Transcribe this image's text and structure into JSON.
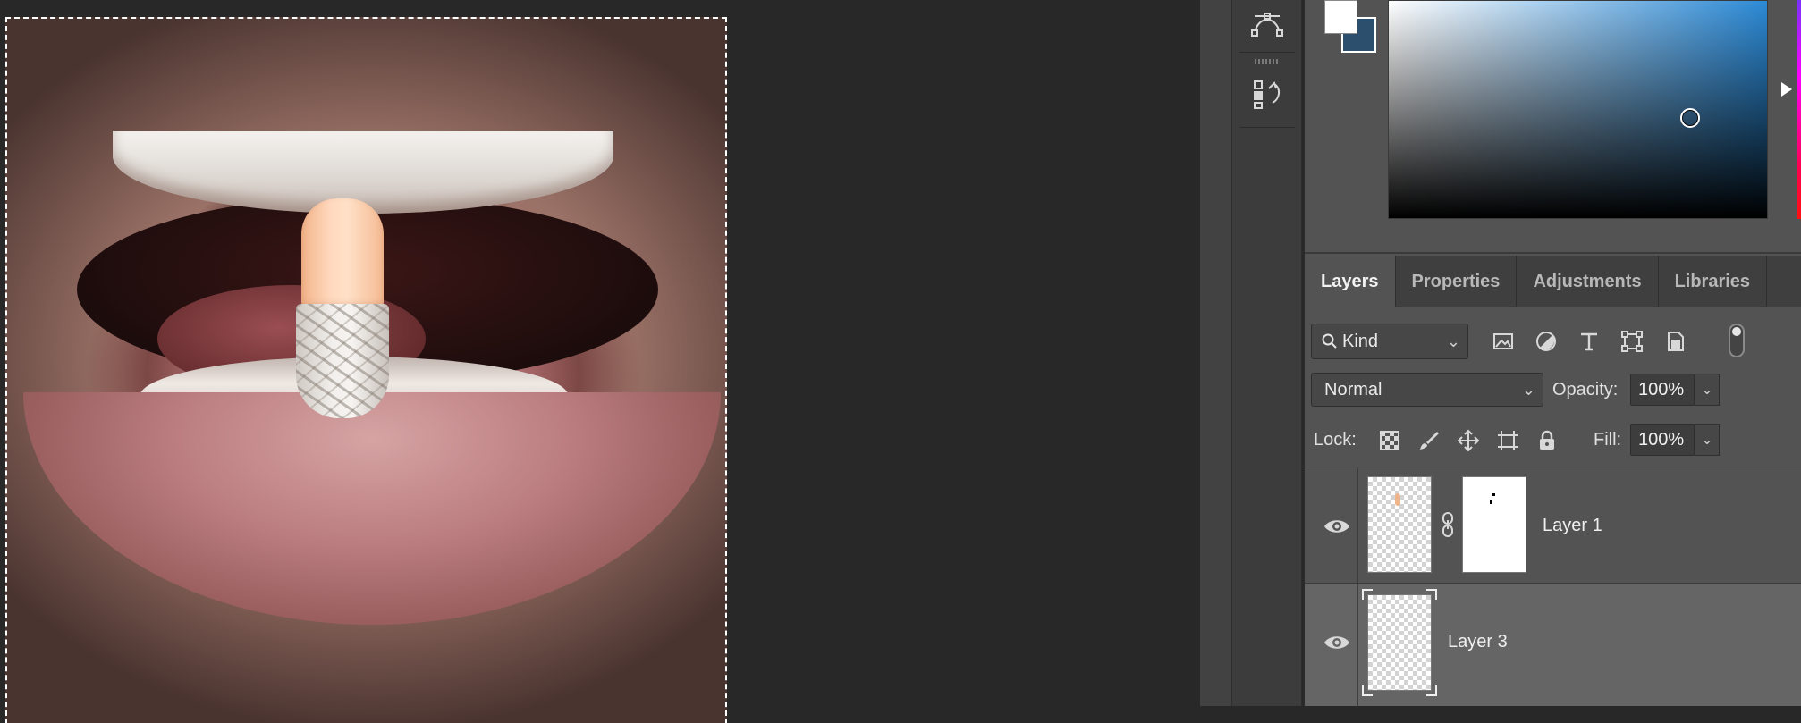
{
  "panels": {
    "tabs": [
      {
        "label": "Layers",
        "active": true
      },
      {
        "label": "Properties",
        "active": false
      },
      {
        "label": "Adjustments",
        "active": false
      },
      {
        "label": "Libraries",
        "active": false
      }
    ],
    "filter": {
      "kind_label": "Kind",
      "icons": [
        "image-filter-icon",
        "adjustment-filter-icon",
        "type-filter-icon",
        "shape-filter-icon",
        "smart-object-filter-icon"
      ]
    },
    "blend": {
      "mode": "Normal",
      "opacity_label": "Opacity:",
      "opacity_value": "100%",
      "lock_label": "Lock:",
      "fill_label": "Fill:",
      "fill_value": "100%"
    },
    "layers": [
      {
        "name": "Layer 1",
        "visible": true,
        "selected": false,
        "has_mask": true
      },
      {
        "name": "Layer 3",
        "visible": true,
        "selected": true,
        "has_mask": false
      }
    ]
  },
  "colors": {
    "foreground": "#ffffff",
    "background": "#2b4f6d",
    "picker_hue": "#2c8ad6"
  },
  "tool_strip": {
    "icons": [
      "pen-path-icon",
      "history-icon"
    ]
  }
}
